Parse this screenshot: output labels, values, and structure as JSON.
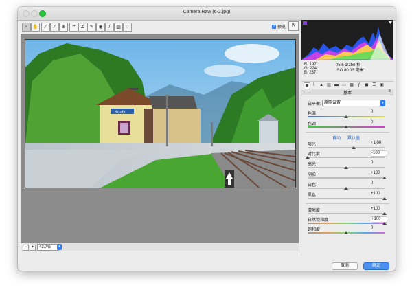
{
  "window": {
    "title": "Camera Raw (6-2.jpg)"
  },
  "toolbar": {
    "tools": [
      "zoom-tool",
      "hand-tool",
      "white-balance-tool",
      "color-sampler-tool",
      "targeted-adjustment-tool",
      "crop-tool",
      "straighten-tool",
      "spot-removal-tool",
      "red-eye-tool",
      "adjustment-brush-tool",
      "graduated-filter-tool",
      "radial-filter-tool"
    ],
    "preview_label": "预览",
    "preview_checked": true
  },
  "status": {
    "zoom": "43.7%"
  },
  "readout": {
    "r": "R:  197",
    "g": "G:  224",
    "b": "B:  237"
  },
  "exif": {
    "line1": "f/5.6   1/250 秒",
    "line2": "ISO 80    13 毫米"
  },
  "panel": {
    "title": "基本",
    "wb_label": "白平衡:",
    "wb_value": "原照设置",
    "temp_label": "色温",
    "temp_value": "0",
    "tint_label": "色调",
    "tint_value": "0",
    "auto": "自动",
    "default": "默认值",
    "exposure_label": "曝光",
    "exposure_value": "+1.00",
    "contrast_label": "对比度",
    "contrast_value": "-100",
    "highlights_label": "高光",
    "highlights_value": "0",
    "shadows_label": "阴影",
    "shadows_value": "+100",
    "whites_label": "白色",
    "whites_value": "0",
    "blacks_label": "黑色",
    "blacks_value": "+100",
    "clarity_label": "清晰度",
    "clarity_value": "+100",
    "vibrance_label": "自然饱和度",
    "vibrance_value": "+100",
    "saturation_label": "饱和度",
    "saturation_value": "0"
  },
  "buttons": {
    "cancel": "取消",
    "ok": "确定"
  },
  "photo": {
    "sign": "Kouty"
  }
}
